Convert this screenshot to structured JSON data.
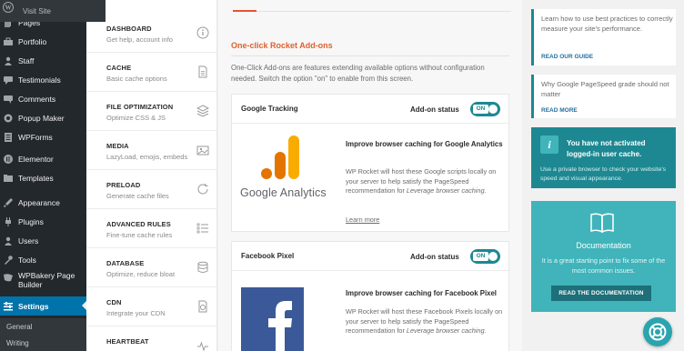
{
  "wp_sidebar": {
    "visit_site": "Visit Site",
    "items": [
      {
        "label": "Pages",
        "icon": "pages-icon"
      },
      {
        "label": "Portfolio",
        "icon": "portfolio-icon"
      },
      {
        "label": "Staff",
        "icon": "staff-icon"
      },
      {
        "label": "Testimonials",
        "icon": "testimonials-icon"
      },
      {
        "label": "Comments",
        "icon": "comments-icon"
      },
      {
        "label": "Popup Maker",
        "icon": "popup-maker-icon"
      },
      {
        "label": "WPForms",
        "icon": "wpforms-icon"
      },
      {
        "label": "Elementor",
        "icon": "elementor-icon"
      },
      {
        "label": "Templates",
        "icon": "templates-icon"
      },
      {
        "label": "Appearance",
        "icon": "appearance-icon"
      },
      {
        "label": "Plugins",
        "icon": "plugins-icon"
      },
      {
        "label": "Users",
        "icon": "users-icon"
      },
      {
        "label": "Tools",
        "icon": "tools-icon"
      },
      {
        "label": "WPBakery Page Builder",
        "icon": "wpbakery-icon"
      },
      {
        "label": "Settings",
        "icon": "settings-icon"
      }
    ],
    "sub_items": [
      "General",
      "Writing"
    ]
  },
  "rocket_nav": [
    {
      "title": "DASHBOARD",
      "sub": "Get help, account info",
      "icon": "info-icon"
    },
    {
      "title": "CACHE",
      "sub": "Basic cache options",
      "icon": "cache-page-icon"
    },
    {
      "title": "FILE OPTIMIZATION",
      "sub": "Optimize CSS & JS",
      "icon": "layers-icon"
    },
    {
      "title": "MEDIA",
      "sub": "LazyLoad, emojis, embeds",
      "icon": "media-icon"
    },
    {
      "title": "PRELOAD",
      "sub": "Generate cache files",
      "icon": "refresh-icon"
    },
    {
      "title": "ADVANCED RULES",
      "sub": "Fine-tune cache rules",
      "icon": "list-icon"
    },
    {
      "title": "DATABASE",
      "sub": "Optimize, reduce bloat",
      "icon": "database-icon"
    },
    {
      "title": "CDN",
      "sub": "Integrate your CDN",
      "icon": "cdn-icon"
    },
    {
      "title": "HEARTBEAT",
      "sub": "",
      "icon": "heartbeat-icon"
    }
  ],
  "main": {
    "section_title": "One-click Rocket Add-ons",
    "section_desc": "One-Click Add-ons are features extending available options without configuration needed. Switch the option \"on\" to enable from this screen.",
    "addons": [
      {
        "name": "Google Tracking",
        "status_label": "Add-on status",
        "toggle": "ON",
        "logo_text": "Google Analytics",
        "heading": "Improve browser caching for Google Analytics",
        "desc_pre": "WP Rocket will host these Google scripts locally on your server to help satisfy the PageSpeed recommendation for ",
        "desc_em": "Leverage browser caching",
        "desc_post": ".",
        "link": "Learn more"
      },
      {
        "name": "Facebook Pixel",
        "status_label": "Add-on status",
        "toggle": "ON",
        "heading": "Improve browser caching for Facebook Pixel",
        "desc_pre": "WP Rocket will host these Facebook Pixels locally on your server to help satisfy the PageSpeed recommendation for ",
        "desc_em": "Leverage browser caching",
        "desc_post": "."
      }
    ]
  },
  "right": {
    "tip1": {
      "text": "Learn how to use best practices to correctly measure your site's performance.",
      "link": "READ OUR GUIDE"
    },
    "tip2": {
      "text": "Why Google PageSpeed grade should not matter",
      "link": "READ MORE"
    },
    "notice": {
      "title": "You have not activated logged-in user cache.",
      "text": "Use a private browser to check your website's speed and visual appearance."
    },
    "docs": {
      "title": "Documentation",
      "text": "It is a great starting point to fix some of the most common issues.",
      "button": "READ THE DOCUMENTATION"
    }
  },
  "colors": {
    "wp_sidebar": "#23282d",
    "wp_active": "#0073aa",
    "rocket_orange": "#e0612c",
    "teal": "#1d8892",
    "light_teal": "#40b4ba",
    "ga_orange": "#f9ab00",
    "ga_dark_orange": "#e37400",
    "facebook_blue": "#3b5998"
  }
}
